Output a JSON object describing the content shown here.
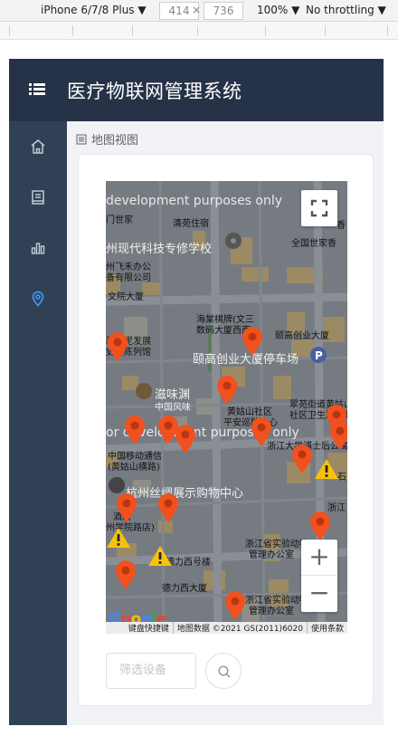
{
  "devtools": {
    "device": "iPhone 6/7/8 Plus ▼",
    "width": "414",
    "times": "×",
    "height": "736",
    "zoom": "100% ▼",
    "throttling": "No throttling ▼"
  },
  "app": {
    "title": "医疗物联网管理系统"
  },
  "sidebar": {
    "items": [
      {
        "icon": "home-icon",
        "active": false
      },
      {
        "icon": "book-icon",
        "active": false
      },
      {
        "icon": "bar-chart-icon",
        "active": false
      },
      {
        "icon": "location-icon",
        "active": true
      }
    ]
  },
  "breadcrumb": {
    "label": "地图视图"
  },
  "map": {
    "watermark_top": "development purposes only",
    "watermark_mid": "or development purposes only",
    "labels": [
      "门世家",
      "清苑住宿",
      "州现代科技专修学校",
      "州飞禾办公",
      "备有限公司",
      "文院大厦",
      "海棠棋牌(文三",
      "数码大厦西南)",
      "颐高创业大厦",
      "颐高创业大厦停车场",
      "装水泥发展",
      "史料陈列馆",
      "滋味渊",
      "中国风味",
      "黄姑山社区",
      "平安巡防中心",
      "翠苑街道黄姑山",
      "社区卫生服务站",
      "中国移动通信",
      "(黄姑山横路)",
      "浙江大学浦士后公寓",
      "杭州丝绸展示购物中心",
      "酒店",
      "州学院路店)",
      "德力西大厦",
      "浙江省实验动物",
      "管理办公室",
      "浙江省实验动物",
      "管理办公室",
      "全国世家香",
      "香",
      "浙江",
      "石",
      "德力西号楼"
    ],
    "attribution": [
      "键盘快捷键",
      "地图数据 ©2021 GS(2011)6020",
      "使用条款"
    ],
    "google": "Google",
    "zoom_in": "+",
    "zoom_out": "−",
    "marker_color": "#f1511e",
    "warning_color": "#f8c20a"
  },
  "filter": {
    "placeholder": "筛选设备"
  }
}
